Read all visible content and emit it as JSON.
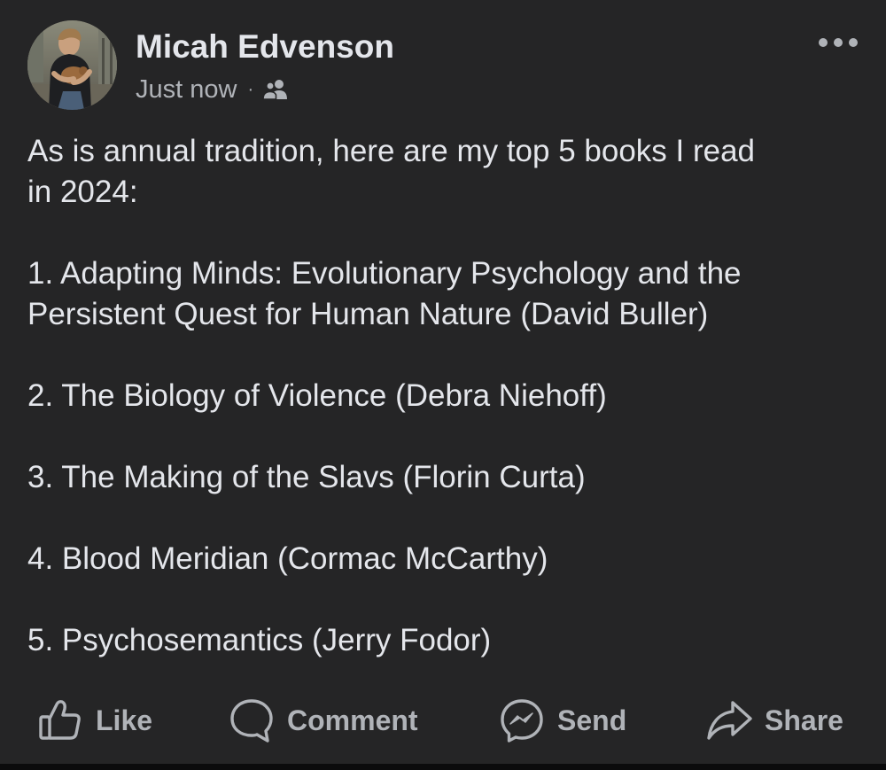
{
  "post": {
    "author": {
      "name": "Micah Edvenson",
      "avatar_icon": "profile-photo"
    },
    "timestamp": "Just now",
    "separator": "·",
    "audience_icon": "friends-icon",
    "more_icon": "more-options-icon",
    "text": {
      "intro_line1": "As is annual tradition, here are my top 5 books I read",
      "intro_line2": "in 2024:",
      "item1_line1": "1. Adapting Minds: Evolutionary Psychology and the",
      "item1_line2": "Persistent Quest for Human Nature (David Buller)",
      "item2": "2. The Biology of Violence (Debra Niehoff)",
      "item3": "3. The Making of the Slavs (Florin Curta)",
      "item4": "4. Blood Meridian (Cormac McCarthy)",
      "item5": "5. Psychosemantics (Jerry Fodor)"
    },
    "actions": {
      "like_label": "Like",
      "comment_label": "Comment",
      "send_label": "Send",
      "share_label": "Share"
    }
  },
  "colors": {
    "background": "#252526",
    "primary_text": "#e4e6eb",
    "secondary_text": "#b0b3b8"
  }
}
